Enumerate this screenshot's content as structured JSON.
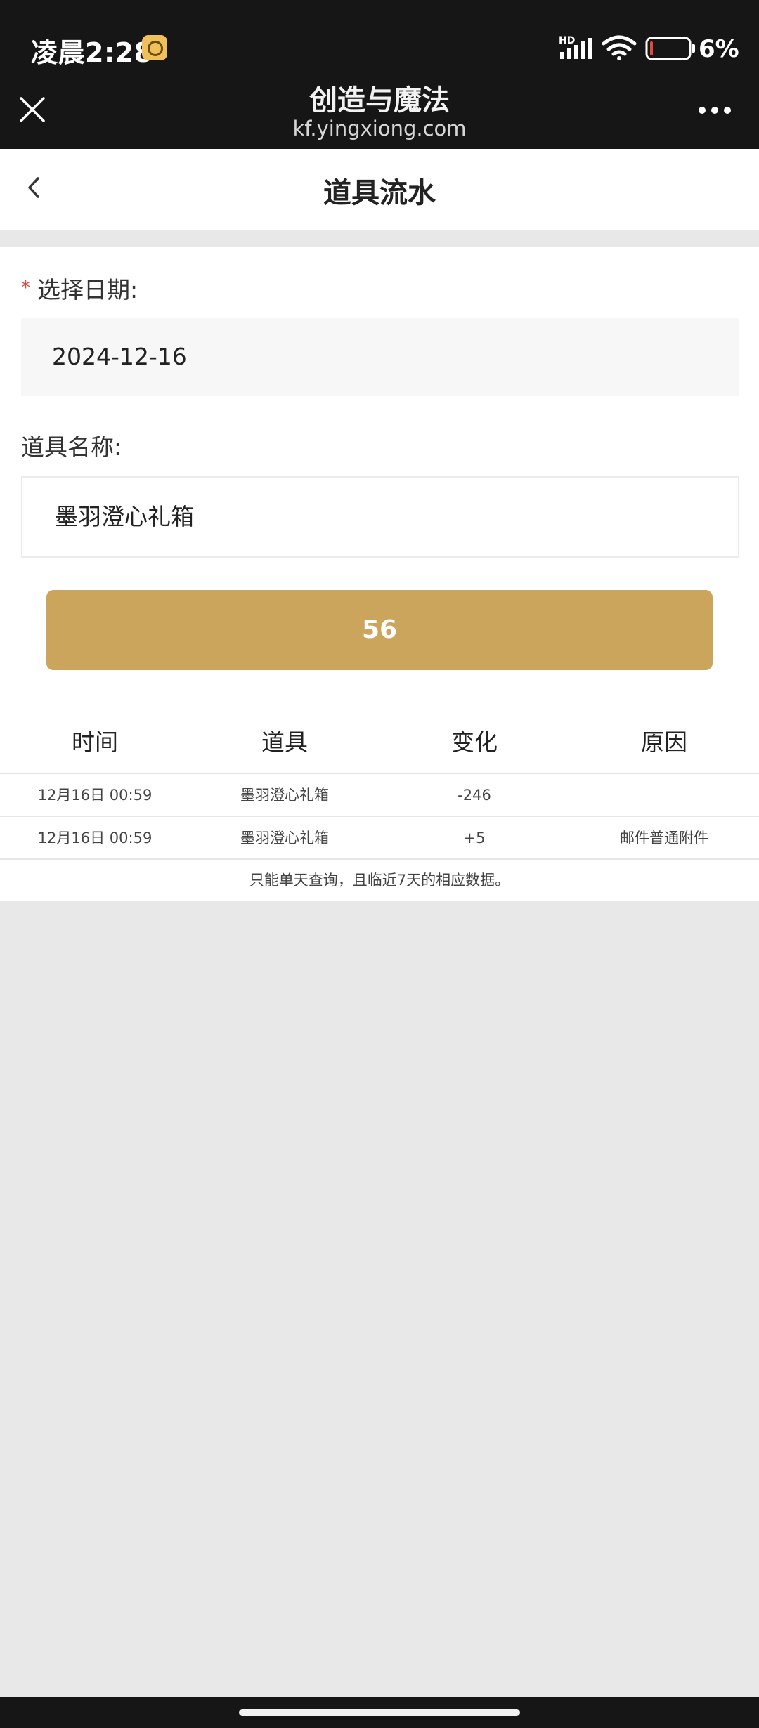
{
  "status_bar": {
    "time": "凌晨2:28",
    "network_badge": "HD",
    "battery_percent": "6%",
    "battery_level": 0.06,
    "icons": [
      "app-notification-icon",
      "signal-icon",
      "wifi-icon",
      "battery-icon"
    ]
  },
  "browser": {
    "title": "创造与魔法",
    "url": "kf.yingxiong.com",
    "close_icon": "close-icon",
    "menu_icon": "more-icon"
  },
  "page": {
    "title": "道具流水",
    "back_icon": "chevron-left-icon"
  },
  "form": {
    "date_label": "选择日期:",
    "required_mark": "*",
    "date_value": "2024-12-16",
    "item_label": "道具名称:",
    "item_value": "墨羽澄心礼箱",
    "button_label": "56",
    "button_color": "#cba55b"
  },
  "table": {
    "headers": [
      "时间",
      "道具",
      "变化",
      "原因"
    ],
    "rows": [
      [
        "12月16日 00:59",
        "墨羽澄心礼箱",
        "-246",
        ""
      ],
      [
        "12月16日 00:59",
        "墨羽澄心礼箱",
        "+5",
        "邮件普通附件"
      ]
    ],
    "note": "只能单天查询，且临近7天的相应数据。"
  }
}
